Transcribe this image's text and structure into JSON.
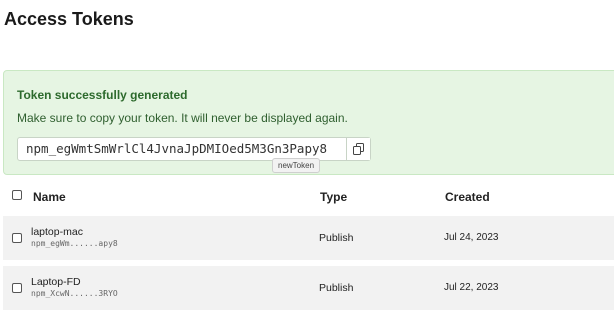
{
  "page": {
    "title": "Access Tokens"
  },
  "success_panel": {
    "heading": "Token successfully generated",
    "message": "Make sure to copy your token. It will never be displayed again.",
    "token_value": "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",
    "copy_icon": "copy-icon",
    "tooltip": "newToken"
  },
  "table": {
    "columns": {
      "name": "Name",
      "type": "Type",
      "created": "Created"
    },
    "rows": [
      {
        "name": "laptop-mac",
        "token": "npm_egWm......apy8",
        "type": "Publish",
        "created": "Jul 24, 2023"
      },
      {
        "name": "Laptop-FD",
        "token": "npm_XcwN......3RYO",
        "type": "Publish",
        "created": "Jul 22, 2023"
      }
    ]
  }
}
